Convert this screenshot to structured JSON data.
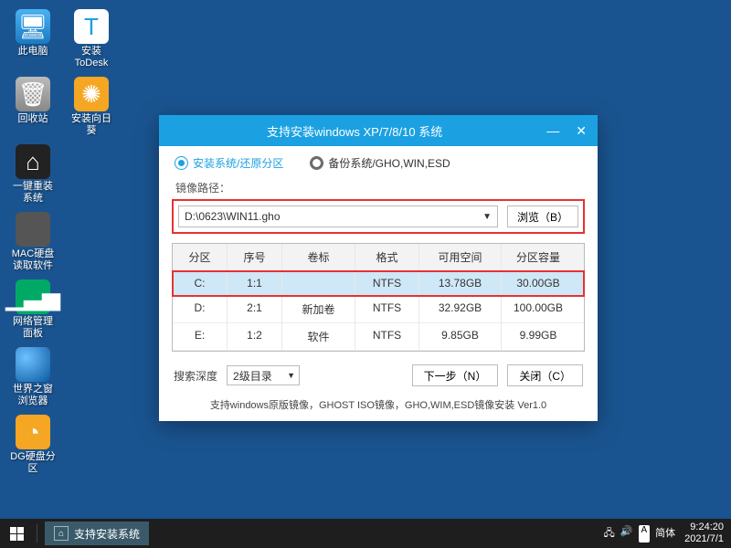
{
  "desktop": {
    "icons": [
      {
        "name": "this-pc",
        "label": "此电脑",
        "g": "g-pc",
        "glyph": "🖥"
      },
      {
        "name": "todesk",
        "label": "安装ToDesk",
        "g": "g-td",
        "glyph": "T"
      },
      {
        "name": "recycle",
        "label": "回收站",
        "g": "g-bin",
        "glyph": "🗑"
      },
      {
        "name": "sunflower",
        "label": "安装向日葵",
        "g": "g-sun",
        "glyph": "✺"
      },
      {
        "name": "reinstall",
        "label": "一键重装系统",
        "g": "g-house",
        "glyph": "⌂"
      },
      {
        "name": "macdisk",
        "label": "MAC硬盘读取软件",
        "g": "g-mac",
        "glyph": ""
      },
      {
        "name": "netpanel",
        "label": "网络管理面板",
        "g": "g-net",
        "glyph": "▁▃▅"
      },
      {
        "name": "browser",
        "label": "世界之窗浏览器",
        "g": "g-globe",
        "glyph": ""
      },
      {
        "name": "dg",
        "label": "DG硬盘分区",
        "g": "g-dg",
        "glyph": "◔"
      }
    ]
  },
  "window": {
    "title": "支持安装windows XP/7/8/10 系统",
    "modes": {
      "install": "安装系统/还原分区",
      "backup": "备份系统/GHO,WIN,ESD"
    },
    "path_label": "镜像路径：",
    "path_value": "D:\\0623\\WIN11.gho",
    "browse": "浏览（B）",
    "table": {
      "headers": [
        "分区",
        "序号",
        "卷标",
        "格式",
        "可用空间",
        "分区容量"
      ],
      "rows": [
        {
          "drive": "C:",
          "idx": "1:1",
          "vol": "",
          "fmt": "NTFS",
          "free": "13.78GB",
          "total": "30.00GB",
          "selected": true
        },
        {
          "drive": "D:",
          "idx": "2:1",
          "vol": "新加卷",
          "fmt": "NTFS",
          "free": "32.92GB",
          "total": "100.00GB",
          "selected": false
        },
        {
          "drive": "E:",
          "idx": "1:2",
          "vol": "软件",
          "fmt": "NTFS",
          "free": "9.85GB",
          "total": "9.99GB",
          "selected": false
        }
      ]
    },
    "depth_label": "搜索深度",
    "depth_value": "2级目录",
    "next": "下一步（N）",
    "close": "关闭（C）",
    "support": "支持windows原版镜像，GHOST ISO镜像，GHO,WIM,ESD镜像安装 Ver1.0"
  },
  "taskbar": {
    "task": "支持安装系统",
    "ime_flag": "A",
    "ime_text": "简体",
    "time": "9:24:20",
    "date": "2021/7/1"
  }
}
